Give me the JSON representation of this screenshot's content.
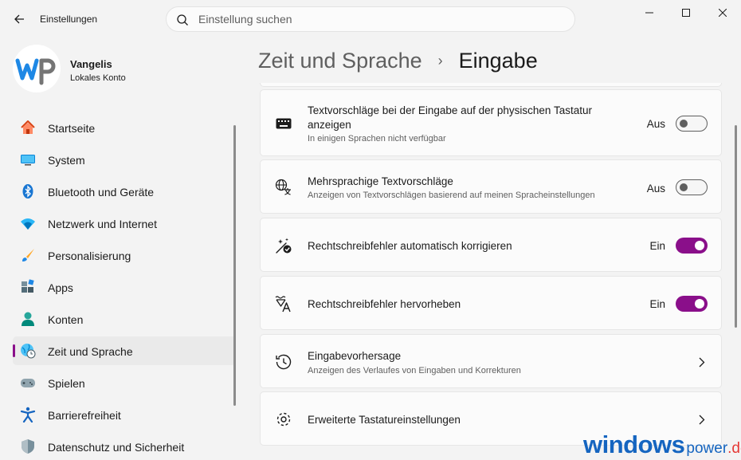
{
  "app": {
    "title": "Einstellungen"
  },
  "search": {
    "placeholder": "Einstellung suchen"
  },
  "user": {
    "name": "Vangelis",
    "account_type": "Lokales Konto",
    "avatar_text": "wp"
  },
  "nav": {
    "items": [
      {
        "label": "Startseite",
        "icon": "home-icon"
      },
      {
        "label": "System",
        "icon": "monitor-icon"
      },
      {
        "label": "Bluetooth und Geräte",
        "icon": "bluetooth-icon"
      },
      {
        "label": "Netzwerk und Internet",
        "icon": "wifi-icon"
      },
      {
        "label": "Personalisierung",
        "icon": "brush-icon"
      },
      {
        "label": "Apps",
        "icon": "apps-icon"
      },
      {
        "label": "Konten",
        "icon": "person-icon"
      },
      {
        "label": "Zeit und Sprache",
        "icon": "globe-clock-icon",
        "active": true
      },
      {
        "label": "Spielen",
        "icon": "gamepad-icon"
      },
      {
        "label": "Barrierefreiheit",
        "icon": "accessibility-icon"
      },
      {
        "label": "Datenschutz und Sicherheit",
        "icon": "shield-icon"
      }
    ]
  },
  "breadcrumb": {
    "parent": "Zeit und Sprache",
    "separator": "›",
    "current": "Eingabe"
  },
  "settings": [
    {
      "title_line1": "Textvorschläge bei der Eingabe auf der physischen Tastatur",
      "title_line2": "anzeigen",
      "description": "In einigen Sprachen nicht verfügbar",
      "state": "Aus",
      "on": false,
      "icon": "keyboard-icon"
    },
    {
      "title": "Mehrsprachige Textvorschläge",
      "description": "Anzeigen von Textvorschlägen basierend auf meinen Spracheinstellungen",
      "state": "Aus",
      "on": false,
      "icon": "language-icon"
    },
    {
      "title": "Rechtschreibfehler automatisch korrigieren",
      "state": "Ein",
      "on": true,
      "icon": "autocorrect-icon"
    },
    {
      "title": "Rechtschreibfehler hervorheben",
      "state": "Ein",
      "on": true,
      "icon": "highlight-text-icon"
    },
    {
      "title": "Eingabevorhersage",
      "description": "Anzeigen des Verlaufes von Eingaben und Korrekturen",
      "icon": "history-icon"
    },
    {
      "title": "Erweiterte Tastatureinstellungen",
      "icon": "gear-icon"
    }
  ],
  "watermark": {
    "main": "windows",
    "sub": "power",
    "tld": ".de"
  },
  "colors": {
    "accent": "#8a0f8a",
    "background": "#f3f3f3",
    "card": "#fbfbfb",
    "watermark": "#1565c0"
  }
}
